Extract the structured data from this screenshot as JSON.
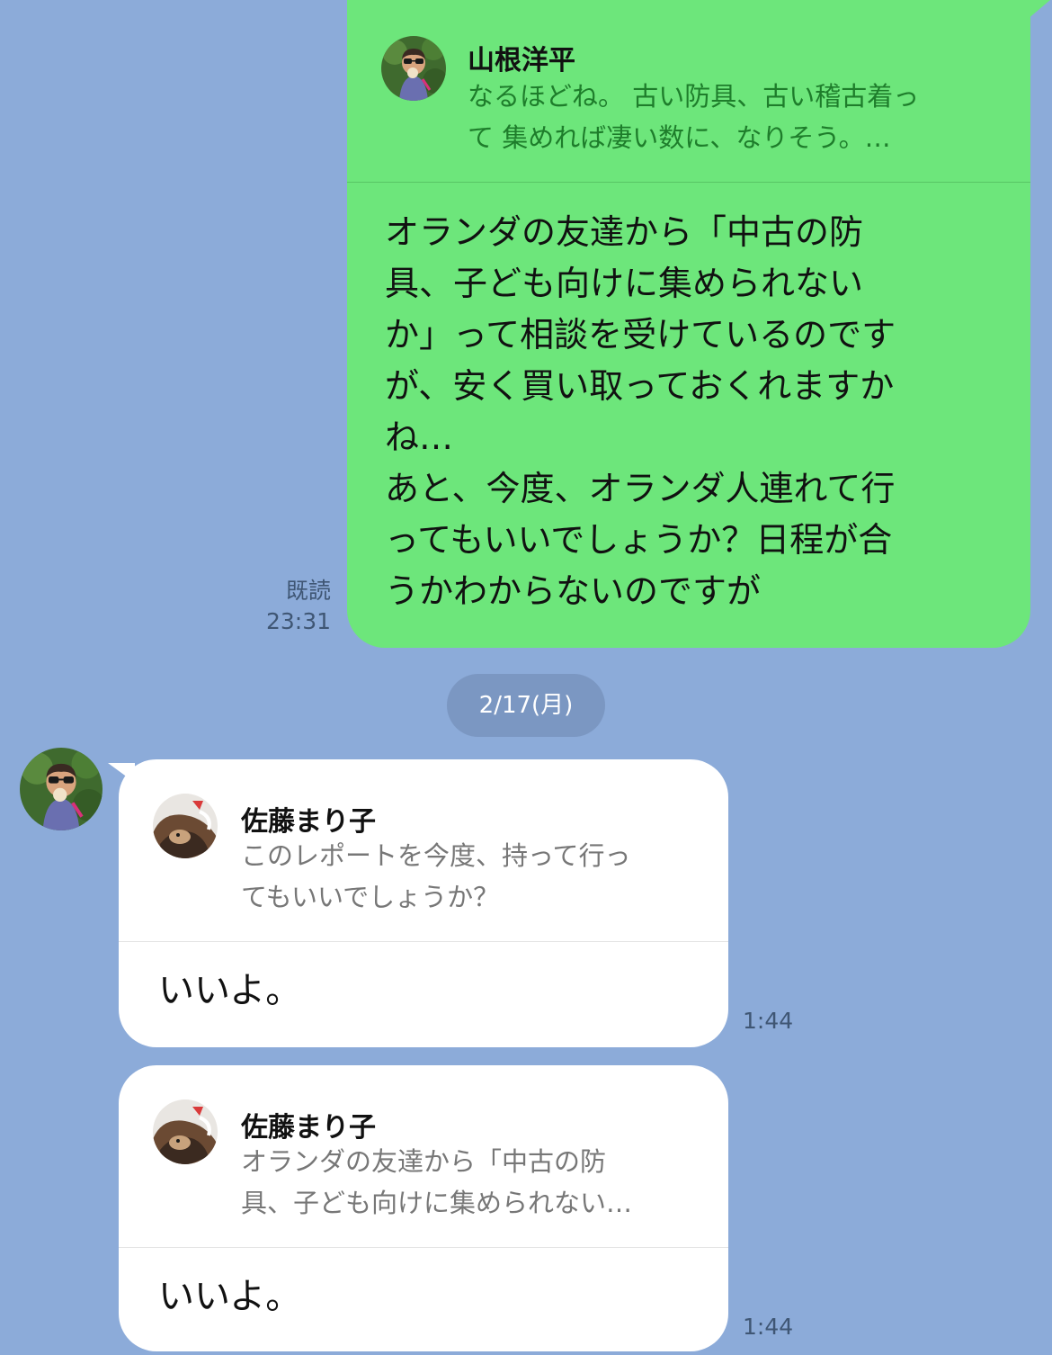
{
  "conversation": {
    "sent_message": {
      "quote": {
        "avatar_icon": "child-photo-avatar",
        "name": "山根洋平",
        "text": "なるほどね。 古い防具、古い稽古着っ\nて 集めれば凄い数に、なりそう。…"
      },
      "body": "オランダの友達から「中古の防\n具、子ども向けに集められない\nか」って相談を受けているのです\nが、安く買い取っておくれますか\nね…\nあと、今度、オランダ人連れて行\nってもいいでしょうか？日程が合\nうかわからないのですが",
      "read_label": "既読",
      "time": "23:31"
    },
    "date_separator": "2/17(月)",
    "received_messages": [
      {
        "quote": {
          "avatar_icon": "cat-photo-avatar",
          "name": "佐藤まり子",
          "text": "このレポートを今度、持って行っ\nてもいいでしょうか？"
        },
        "body": "いいよ。",
        "time": "1:44"
      },
      {
        "quote": {
          "avatar_icon": "cat-photo-avatar",
          "name": "佐藤まり子",
          "text": "オランダの友達から「中古の防\n具、子ども向けに集められない…"
        },
        "body": "いいよ。",
        "time": "1:44"
      }
    ]
  },
  "colors": {
    "background": "#8cabd9",
    "sent_bubble": "#6de67b",
    "received_bubble": "#ffffff",
    "date_pill": "#7b97c2"
  }
}
